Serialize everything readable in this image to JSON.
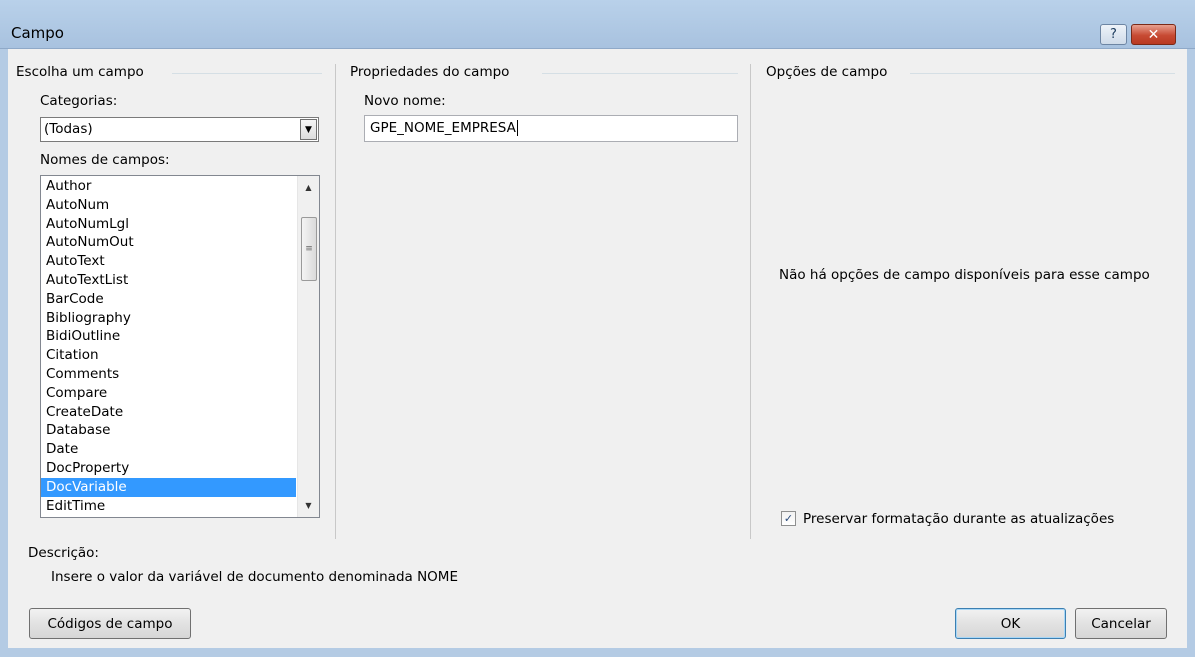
{
  "window": {
    "title": "Campo",
    "help_glyph": "?",
    "close_glyph": "✕"
  },
  "choose_field": {
    "section_title": "Escolha um campo",
    "categories_label": "Categorias:",
    "categories_value": "(Todas)",
    "field_names_label": "Nomes de campos:",
    "items": [
      "Author",
      "AutoNum",
      "AutoNumLgl",
      "AutoNumOut",
      "AutoText",
      "AutoTextList",
      "BarCode",
      "Bibliography",
      "BidiOutline",
      "Citation",
      "Comments",
      "Compare",
      "CreateDate",
      "Database",
      "Date",
      "DocProperty",
      "DocVariable",
      "EditTime"
    ],
    "selected_item": "DocVariable"
  },
  "field_properties": {
    "section_title": "Propriedades do campo",
    "new_name_label": "Novo nome:",
    "new_name_value": "GPE_NOME_EMPRESA"
  },
  "field_options": {
    "section_title": "Opções de campo",
    "no_options_message": "Não há opções de campo disponíveis para esse campo",
    "preserve_label": "Preservar formatação durante as atualizações",
    "preserve_checked": true
  },
  "description": {
    "label": "Descrição:",
    "text": "Insere o valor da variável de documento denominada NOME"
  },
  "buttons": {
    "field_codes": "Códigos de campo",
    "ok": "OK",
    "cancel": "Cancelar"
  },
  "colors": {
    "selection": "#3399ff",
    "titlebar": "#b9d1ea",
    "close_button": "#c74a33"
  }
}
